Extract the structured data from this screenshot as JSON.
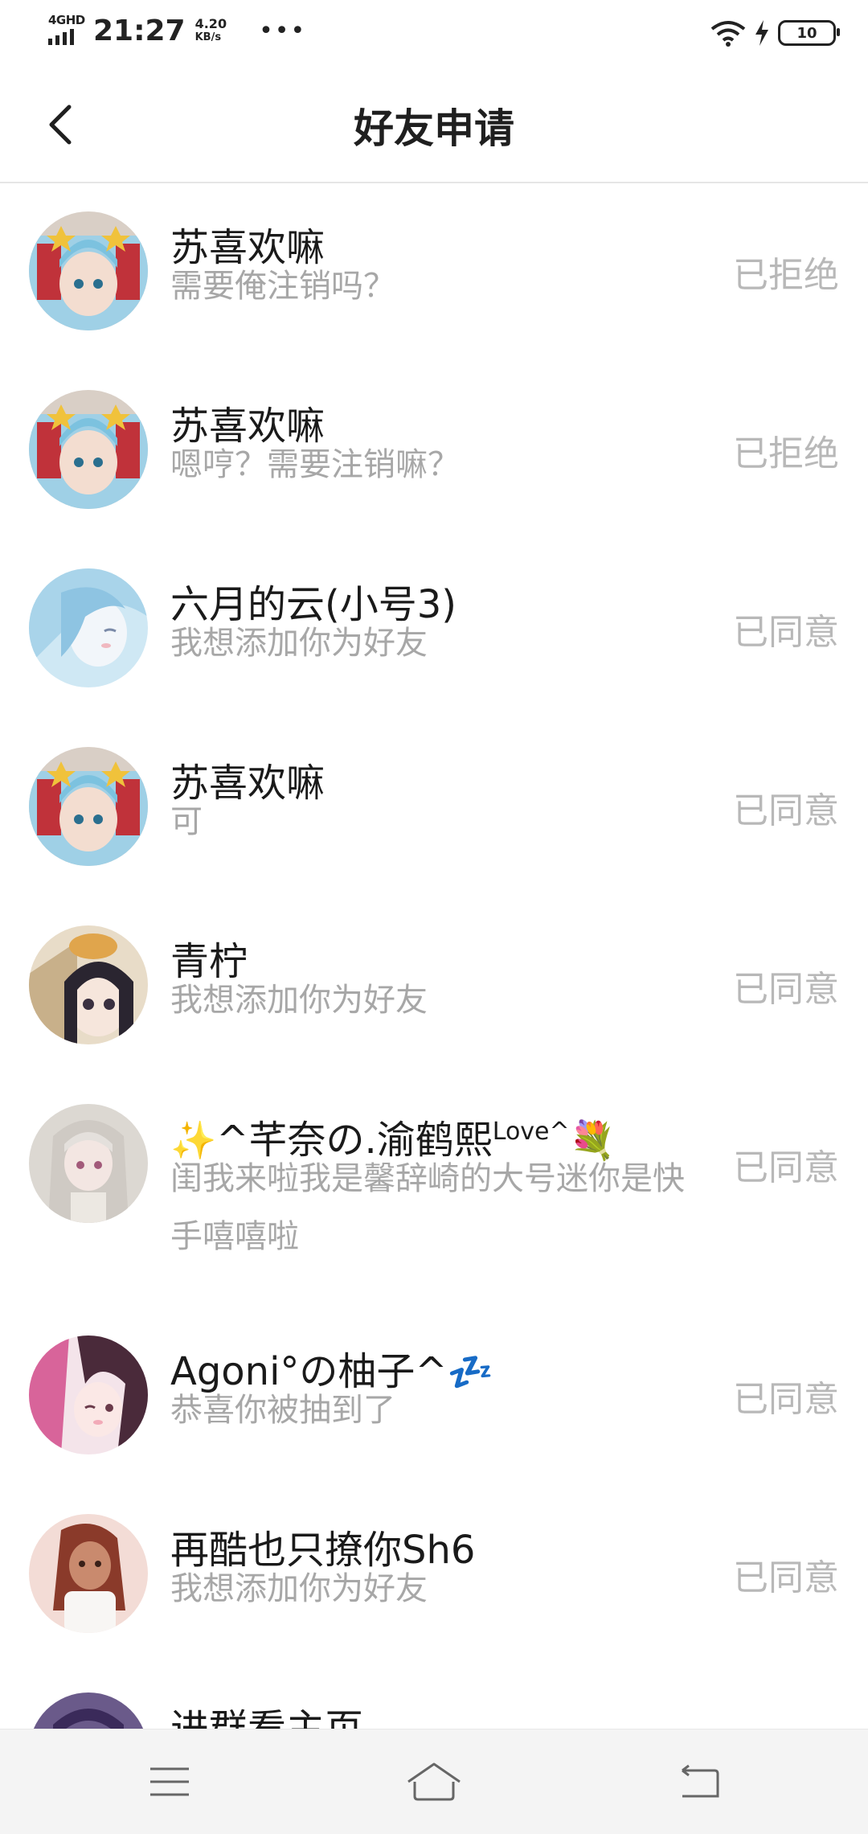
{
  "status_bar": {
    "network": "4GHD",
    "time": "21:27",
    "speed_value": "4.20",
    "speed_unit": "KB/s",
    "more": "•••",
    "battery": "10"
  },
  "header": {
    "title": "好友申请",
    "back_icon": "chevron-left-icon"
  },
  "requests": [
    {
      "name": "苏喜欢嘛",
      "message": "需要俺注销吗？",
      "status": "已拒绝",
      "avatar": "anime-girl-blue-hair"
    },
    {
      "name": "苏喜欢嘛",
      "message": "嗯哼？需要注销嘛？",
      "status": "已拒绝",
      "avatar": "anime-girl-blue-hair"
    },
    {
      "name": "六月的云(小号3)",
      "message": "我想添加你为好友",
      "status": "已同意",
      "avatar": "anime-girl-pale-blue"
    },
    {
      "name": "苏喜欢嘛",
      "message": "可",
      "status": "已同意",
      "avatar": "anime-girl-blue-hair"
    },
    {
      "name": "青柠",
      "message": "我想添加你为好友",
      "status": "已同意",
      "avatar": "anime-girl-cat"
    },
    {
      "name_prefix": "✨",
      "name": "^芊奈の.渝鹤熙",
      "name_sup": "Love^",
      "name_suffix": "💐",
      "message": "闺我来啦我是馨辞崎的大号迷你是快手嘻嘻啦",
      "status": "已同意",
      "avatar": "anime-girl-silver-hair"
    },
    {
      "name": "Agoni°の柚子^",
      "name_suffix": "💤",
      "message": "恭喜你被抽到了",
      "status": "已同意",
      "avatar": "anime-girl-pink"
    },
    {
      "name": "再酷也只撩你Sh6",
      "message": "我想添加你为好友",
      "status": "已同意",
      "avatar": "girl-red-hair"
    },
    {
      "name": "进群看主页",
      "message": "",
      "status": "",
      "avatar": "dark-portrait"
    }
  ],
  "bottom_nav": {
    "menu_icon": "menu-icon",
    "home_icon": "home-icon",
    "back_icon": "back-icon"
  },
  "colors": {
    "status_text": "#b8b8b8",
    "message_text": "#a7a7a7",
    "name_text": "#1a1a1a"
  }
}
